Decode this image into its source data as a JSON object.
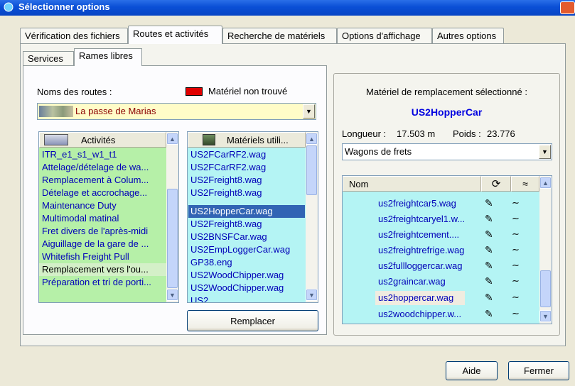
{
  "window": {
    "title": "Sélectionner options"
  },
  "tabs": [
    {
      "label": "Vérification des fichiers"
    },
    {
      "label": "Routes et activités"
    },
    {
      "label": "Recherche de matériels"
    },
    {
      "label": "Options d'affichage"
    },
    {
      "label": "Autres options"
    }
  ],
  "subtabs": [
    {
      "label": "Services"
    },
    {
      "label": "Rames libres"
    }
  ],
  "routes": {
    "label": "Noms des routes :",
    "legend_label": "Matériel non trouvé",
    "legend_color": "#e00000",
    "selected_route": "La passe de Marias"
  },
  "activities": {
    "header": "Activités",
    "items": [
      {
        "label": "ITR_e1_s1_w1_t1",
        "found": true
      },
      {
        "label": "Attelage/dételage de wa...",
        "found": true
      },
      {
        "label": "Remplacement à Colum...",
        "found": true
      },
      {
        "label": "Dételage et accrochage...",
        "found": true
      },
      {
        "label": "Maintenance Duty",
        "found": true
      },
      {
        "label": "Multimodal matinal",
        "found": true
      },
      {
        "label": "Fret divers de l'après-midi",
        "found": true
      },
      {
        "label": "Aiguillage de la gare de ...",
        "found": true
      },
      {
        "label": "Whitefish Freight Pull",
        "found": true
      },
      {
        "label": "Remplacement vers l'ou...",
        "found": false
      },
      {
        "label": "Préparation et tri de porti...",
        "found": true
      }
    ]
  },
  "consists": {
    "header": "Matériels utili...",
    "items": [
      {
        "label": "US2FCarRF2.wag"
      },
      {
        "label": "US2FCarRF2.wag"
      },
      {
        "label": "US2Freight8.wag"
      },
      {
        "label": "US2Freight8.wag"
      },
      {
        "label": "US2HopperCar.wag"
      },
      {
        "label": "US2Freight8.wag"
      },
      {
        "label": "US2BNSFCar.wag"
      },
      {
        "label": "US2EmpLoggerCar.wag"
      },
      {
        "label": "GP38.eng"
      },
      {
        "label": "US2WoodChipper.wag"
      },
      {
        "label": "US2WoodChipper.wag"
      },
      {
        "label": "US2...."
      }
    ],
    "selected_index": 4
  },
  "replace_button": "Remplacer",
  "replacement": {
    "title": "Matériel de remplacement sélectionné :",
    "selected_name": "US2HopperCar",
    "length_label": "Longueur :",
    "length_value": "17.503 m",
    "weight_label": "Poids :",
    "weight_value": "23.776",
    "category": "Wagons de frets",
    "column_name": "Nom",
    "items": [
      {
        "label": "us2freightcar5.wag"
      },
      {
        "label": "us2freightcaryel1.w..."
      },
      {
        "label": "us2freightcement...."
      },
      {
        "label": "us2freightrefrige.wag"
      },
      {
        "label": "us2fullloggercar.wag"
      },
      {
        "label": "us2graincar.wag"
      },
      {
        "label": "us2hoppercar.wag"
      },
      {
        "label": "us2woodchipper.w..."
      }
    ],
    "selected_index": 6
  },
  "footer": {
    "help_button": "Aide",
    "close_button": "Fermer"
  },
  "colors": {
    "activity_found_bg": "#b6f0a8",
    "consist_bg": "#b4f4f4",
    "selection_bg": "#3164b4",
    "selected_name_color": "#0000e0",
    "route_bg": "#fffcc8"
  }
}
